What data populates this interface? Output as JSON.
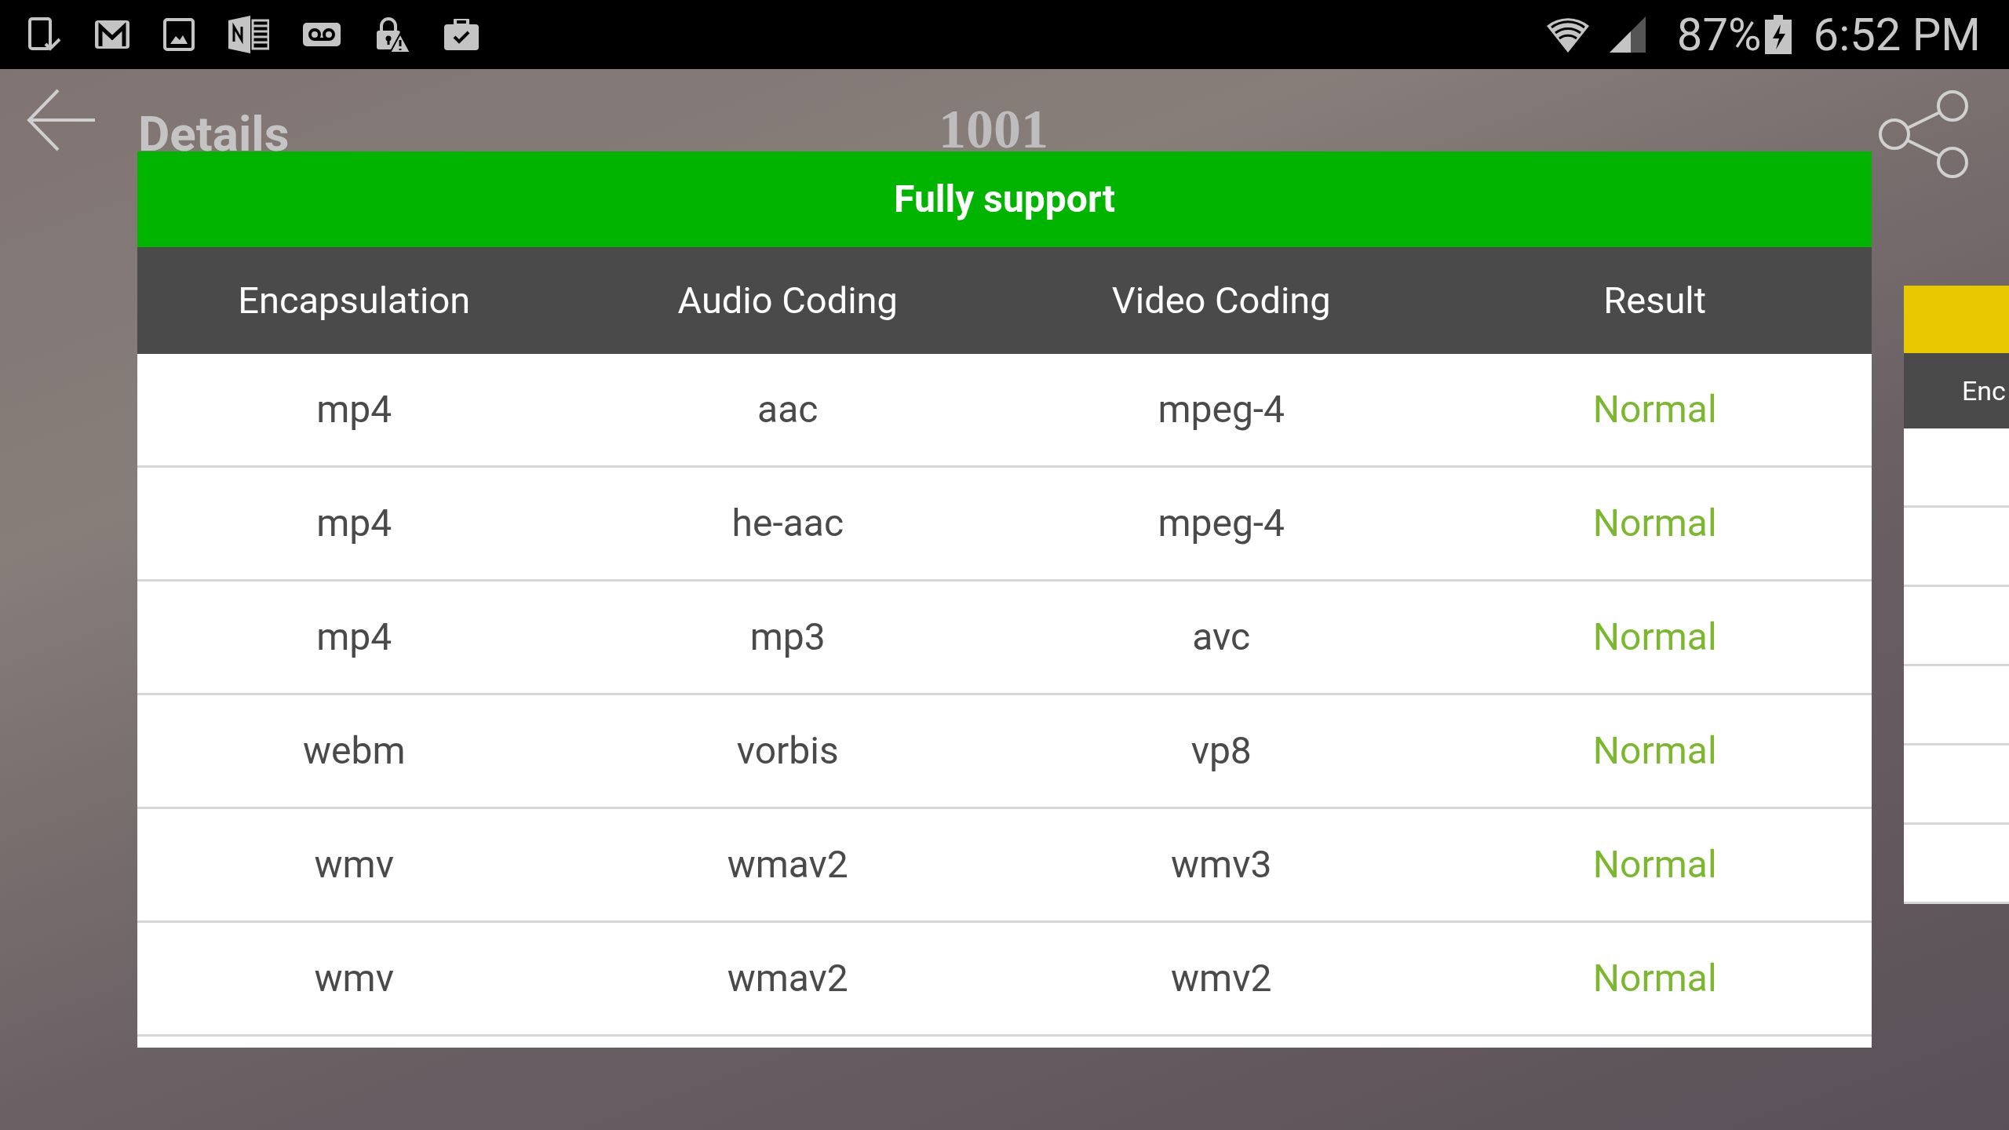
{
  "status_bar": {
    "battery": "87%",
    "time": "6:52 PM"
  },
  "header": {
    "title": "Details",
    "number": "1001"
  },
  "cards": [
    {
      "title": "Fully support",
      "color": "#00b400",
      "columns": [
        "Encapsulation",
        "Audio Coding",
        "Video Coding",
        "Result"
      ],
      "rows": [
        {
          "cells": [
            "mp4",
            "aac",
            "mpeg-4",
            "Normal"
          ]
        },
        {
          "cells": [
            "mp4",
            "he-aac",
            "mpeg-4",
            "Normal"
          ]
        },
        {
          "cells": [
            "mp4",
            "mp3",
            "avc",
            "Normal"
          ]
        },
        {
          "cells": [
            "webm",
            "vorbis",
            "vp8",
            "Normal"
          ]
        },
        {
          "cells": [
            "wmv",
            "wmav2",
            "wmv3",
            "Normal"
          ]
        },
        {
          "cells": [
            "wmv",
            "wmav2",
            "wmv2",
            "Normal"
          ]
        }
      ]
    },
    {
      "color": "#e8c800",
      "columns": [
        "Enc"
      ]
    }
  ]
}
